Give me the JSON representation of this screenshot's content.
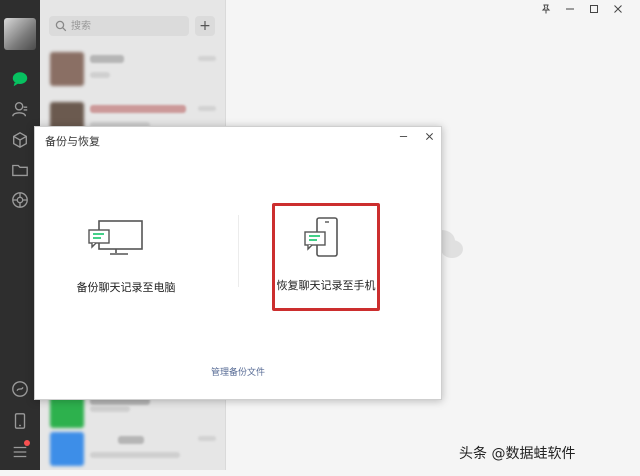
{
  "search": {
    "placeholder": "搜索"
  },
  "header": {
    "add_label": "+"
  },
  "dialog": {
    "title": "备份与恢复",
    "backup_to_pc_label": "备份聊天记录至电脑",
    "restore_to_phone_label": "恢复聊天记录至手机",
    "manage_files_label": "管理备份文件"
  },
  "chat_list": {
    "items": [
      {
        "avatar_color": "#8a6f64",
        "blue_chip": false
      },
      {
        "avatar_color": "#6b5a4f",
        "blue_chip": false
      },
      {
        "avatar_color": "#2db14d",
        "blue_chip": false
      },
      {
        "avatar_color": "#3d8ee8",
        "blue_chip": true
      }
    ]
  },
  "colors": {
    "rail_bg": "#2e2e2e",
    "active_chat_icon": "#07c160",
    "highlight_border": "#cc2e2e",
    "link": "#576b95"
  },
  "icons": {
    "rail": [
      "chat-icon",
      "contacts-icon",
      "favorites-cube-icon",
      "folder-icon",
      "moments-icon",
      "mini-program-icon",
      "phone-icon",
      "menu-icon"
    ],
    "window": [
      "pin-icon",
      "minimize-icon",
      "maximize-icon",
      "close-icon"
    ]
  },
  "watermark": {
    "text": "头条 @数据蛙软件"
  }
}
